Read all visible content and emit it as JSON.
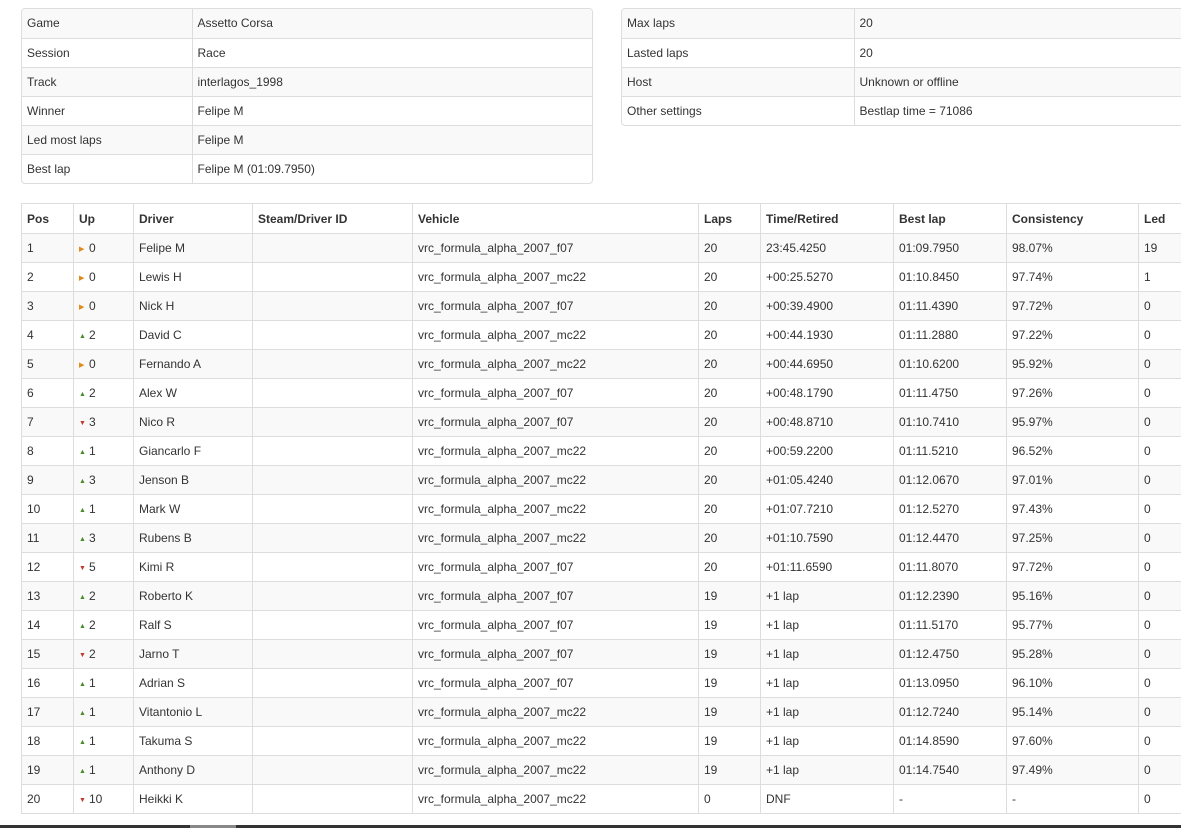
{
  "info_left": [
    {
      "label": "Game",
      "value": "Assetto Corsa"
    },
    {
      "label": "Session",
      "value": "Race"
    },
    {
      "label": "Track",
      "value": "interlagos_1998"
    },
    {
      "label": "Winner",
      "value": "Felipe M"
    },
    {
      "label": "Led most laps",
      "value": "Felipe M"
    },
    {
      "label": "Best lap",
      "value": "Felipe M (01:09.7950)"
    }
  ],
  "info_right": [
    {
      "label": "Max laps",
      "value": "20"
    },
    {
      "label": "Lasted laps",
      "value": "20"
    },
    {
      "label": "Host",
      "value": "Unknown or offline"
    },
    {
      "label": "Other settings",
      "value": "Bestlap time = 71086"
    }
  ],
  "results": {
    "headers": {
      "pos": "Pos",
      "up": "Up",
      "driver": "Driver",
      "steam_id": "Steam/Driver ID",
      "vehicle": "Vehicle",
      "laps": "Laps",
      "time": "Time/Retired",
      "best_lap": "Best lap",
      "consistency": "Consistency",
      "led": "Led"
    },
    "rows": [
      {
        "pos": "1",
        "dir": "same",
        "up": "0",
        "driver": "Felipe M",
        "steam_id": "",
        "vehicle": "vrc_formula_alpha_2007_f07",
        "laps": "20",
        "time": "23:45.4250",
        "best_lap": "01:09.7950",
        "consistency": "98.07%",
        "led": "19"
      },
      {
        "pos": "2",
        "dir": "same",
        "up": "0",
        "driver": "Lewis H",
        "steam_id": "",
        "vehicle": "vrc_formula_alpha_2007_mc22",
        "laps": "20",
        "time": "+00:25.5270",
        "best_lap": "01:10.8450",
        "consistency": "97.74%",
        "led": "1"
      },
      {
        "pos": "3",
        "dir": "same",
        "up": "0",
        "driver": "Nick H",
        "steam_id": "",
        "vehicle": "vrc_formula_alpha_2007_f07",
        "laps": "20",
        "time": "+00:39.4900",
        "best_lap": "01:11.4390",
        "consistency": "97.72%",
        "led": "0"
      },
      {
        "pos": "4",
        "dir": "up",
        "up": "2",
        "driver": "David C",
        "steam_id": "",
        "vehicle": "vrc_formula_alpha_2007_mc22",
        "laps": "20",
        "time": "+00:44.1930",
        "best_lap": "01:11.2880",
        "consistency": "97.22%",
        "led": "0"
      },
      {
        "pos": "5",
        "dir": "same",
        "up": "0",
        "driver": "Fernando A",
        "steam_id": "",
        "vehicle": "vrc_formula_alpha_2007_mc22",
        "laps": "20",
        "time": "+00:44.6950",
        "best_lap": "01:10.6200",
        "consistency": "95.92%",
        "led": "0"
      },
      {
        "pos": "6",
        "dir": "up",
        "up": "2",
        "driver": "Alex W",
        "steam_id": "",
        "vehicle": "vrc_formula_alpha_2007_f07",
        "laps": "20",
        "time": "+00:48.1790",
        "best_lap": "01:11.4750",
        "consistency": "97.26%",
        "led": "0"
      },
      {
        "pos": "7",
        "dir": "down",
        "up": "3",
        "driver": "Nico R",
        "steam_id": "",
        "vehicle": "vrc_formula_alpha_2007_f07",
        "laps": "20",
        "time": "+00:48.8710",
        "best_lap": "01:10.7410",
        "consistency": "95.97%",
        "led": "0"
      },
      {
        "pos": "8",
        "dir": "up",
        "up": "1",
        "driver": "Giancarlo F",
        "steam_id": "",
        "vehicle": "vrc_formula_alpha_2007_mc22",
        "laps": "20",
        "time": "+00:59.2200",
        "best_lap": "01:11.5210",
        "consistency": "96.52%",
        "led": "0"
      },
      {
        "pos": "9",
        "dir": "up",
        "up": "3",
        "driver": "Jenson B",
        "steam_id": "",
        "vehicle": "vrc_formula_alpha_2007_mc22",
        "laps": "20",
        "time": "+01:05.4240",
        "best_lap": "01:12.0670",
        "consistency": "97.01%",
        "led": "0"
      },
      {
        "pos": "10",
        "dir": "up",
        "up": "1",
        "driver": "Mark W",
        "steam_id": "",
        "vehicle": "vrc_formula_alpha_2007_mc22",
        "laps": "20",
        "time": "+01:07.7210",
        "best_lap": "01:12.5270",
        "consistency": "97.43%",
        "led": "0"
      },
      {
        "pos": "11",
        "dir": "up",
        "up": "3",
        "driver": "Rubens B",
        "steam_id": "",
        "vehicle": "vrc_formula_alpha_2007_mc22",
        "laps": "20",
        "time": "+01:10.7590",
        "best_lap": "01:12.4470",
        "consistency": "97.25%",
        "led": "0"
      },
      {
        "pos": "12",
        "dir": "down",
        "up": "5",
        "driver": "Kimi R",
        "steam_id": "",
        "vehicle": "vrc_formula_alpha_2007_f07",
        "laps": "20",
        "time": "+01:11.6590",
        "best_lap": "01:11.8070",
        "consistency": "97.72%",
        "led": "0"
      },
      {
        "pos": "13",
        "dir": "up",
        "up": "2",
        "driver": "Roberto K",
        "steam_id": "",
        "vehicle": "vrc_formula_alpha_2007_f07",
        "laps": "19",
        "time": "+1 lap",
        "best_lap": "01:12.2390",
        "consistency": "95.16%",
        "led": "0"
      },
      {
        "pos": "14",
        "dir": "up",
        "up": "2",
        "driver": "Ralf S",
        "steam_id": "",
        "vehicle": "vrc_formula_alpha_2007_f07",
        "laps": "19",
        "time": "+1 lap",
        "best_lap": "01:11.5170",
        "consistency": "95.77%",
        "led": "0"
      },
      {
        "pos": "15",
        "dir": "down",
        "up": "2",
        "driver": "Jarno T",
        "steam_id": "",
        "vehicle": "vrc_formula_alpha_2007_f07",
        "laps": "19",
        "time": "+1 lap",
        "best_lap": "01:12.4750",
        "consistency": "95.28%",
        "led": "0"
      },
      {
        "pos": "16",
        "dir": "up",
        "up": "1",
        "driver": "Adrian S",
        "steam_id": "",
        "vehicle": "vrc_formula_alpha_2007_f07",
        "laps": "19",
        "time": "+1 lap",
        "best_lap": "01:13.0950",
        "consistency": "96.10%",
        "led": "0"
      },
      {
        "pos": "17",
        "dir": "up",
        "up": "1",
        "driver": "Vitantonio L",
        "steam_id": "",
        "vehicle": "vrc_formula_alpha_2007_mc22",
        "laps": "19",
        "time": "+1 lap",
        "best_lap": "01:12.7240",
        "consistency": "95.14%",
        "led": "0"
      },
      {
        "pos": "18",
        "dir": "up",
        "up": "1",
        "driver": "Takuma S",
        "steam_id": "",
        "vehicle": "vrc_formula_alpha_2007_mc22",
        "laps": "19",
        "time": "+1 lap",
        "best_lap": "01:14.8590",
        "consistency": "97.60%",
        "led": "0"
      },
      {
        "pos": "19",
        "dir": "up",
        "up": "1",
        "driver": "Anthony D",
        "steam_id": "",
        "vehicle": "vrc_formula_alpha_2007_mc22",
        "laps": "19",
        "time": "+1 lap",
        "best_lap": "01:14.7540",
        "consistency": "97.49%",
        "led": "0"
      },
      {
        "pos": "20",
        "dir": "down",
        "up": "10",
        "driver": "Heikki K",
        "steam_id": "",
        "vehicle": "vrc_formula_alpha_2007_mc22",
        "laps": "0",
        "time": "DNF",
        "best_lap": "-",
        "consistency": "-",
        "led": "0"
      }
    ]
  },
  "icons": {
    "up": "triangle-up-icon",
    "down": "triangle-down-icon",
    "same": "triangle-right-icon"
  },
  "colors": {
    "up": "#4a8a2a",
    "down": "#c0392b",
    "same": "#e08a1a",
    "stripe": "#f9f9f9",
    "border": "#dddddd"
  }
}
